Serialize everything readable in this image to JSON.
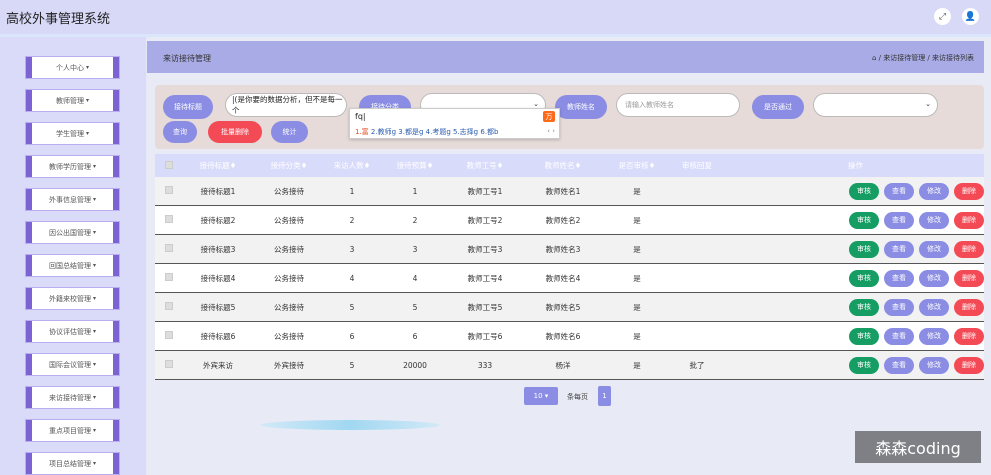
{
  "app": {
    "title": "高校外事管理系统"
  },
  "header": {
    "fullscreen_icon": "fullscreen-icon",
    "user_icon": "user-icon"
  },
  "sidebar": {
    "items": [
      {
        "label": "个人中心"
      },
      {
        "label": "教师管理"
      },
      {
        "label": "学生管理"
      },
      {
        "label": "教师学历管理"
      },
      {
        "label": "外事信息管理"
      },
      {
        "label": "因公出国管理"
      },
      {
        "label": "回国总结管理"
      },
      {
        "label": "外籍来校管理"
      },
      {
        "label": "协议评估管理"
      },
      {
        "label": "国际会议管理"
      },
      {
        "label": "来访接待管理"
      },
      {
        "label": "重点项目管理"
      },
      {
        "label": "项目总结管理"
      }
    ]
  },
  "breadcrumb": {
    "title": "来访接待管理",
    "path": "⌂ / 来访接待管理 / 来访接待列表"
  },
  "search": {
    "title_label": "接待标题",
    "title_value": "|(是你要的数据分析，但不是每一个",
    "category_label": "接待分类",
    "teacher_name_label": "教师姓名",
    "teacher_name_placeholder": "请输入教师姓名",
    "approved_label": "是否通过",
    "query_button": "查询",
    "batch_delete_button": "批量删除",
    "stats_button": "统计"
  },
  "ime": {
    "input": "fq|",
    "logo": "万",
    "candidates": [
      "1.富",
      "2.教师g",
      "3.都是g",
      "4.考题g",
      "5.志择g",
      "6.都b"
    ],
    "arrows": "‹ ›"
  },
  "table": {
    "columns": [
      "接待标题♦",
      "接待分类♦",
      "来访人数♦",
      "接待预算♦",
      "教师工号♦",
      "教师姓名♦",
      "是否审核♦",
      "审核回复",
      "操作"
    ],
    "rows": [
      {
        "title": "接待标题1",
        "category": "公务接待",
        "visitors": "1",
        "budget": "1",
        "teacher_no": "教师工号1",
        "teacher_name": "教师姓名1",
        "approved": "是",
        "reply": ""
      },
      {
        "title": "接待标题2",
        "category": "公务接待",
        "visitors": "2",
        "budget": "2",
        "teacher_no": "教师工号2",
        "teacher_name": "教师姓名2",
        "approved": "是",
        "reply": ""
      },
      {
        "title": "接待标题3",
        "category": "公务接待",
        "visitors": "3",
        "budget": "3",
        "teacher_no": "教师工号3",
        "teacher_name": "教师姓名3",
        "approved": "是",
        "reply": ""
      },
      {
        "title": "接待标题4",
        "category": "公务接待",
        "visitors": "4",
        "budget": "4",
        "teacher_no": "教师工号4",
        "teacher_name": "教师姓名4",
        "approved": "是",
        "reply": ""
      },
      {
        "title": "接待标题5",
        "category": "公务接待",
        "visitors": "5",
        "budget": "5",
        "teacher_no": "教师工号5",
        "teacher_name": "教师姓名5",
        "approved": "是",
        "reply": ""
      },
      {
        "title": "接待标题6",
        "category": "公务接待",
        "visitors": "6",
        "budget": "6",
        "teacher_no": "教师工号6",
        "teacher_name": "教师姓名6",
        "approved": "是",
        "reply": ""
      },
      {
        "title": "外宾来访",
        "category": "外宾接待",
        "visitors": "5",
        "budget": "20000",
        "teacher_no": "333",
        "teacher_name": "杨洋",
        "approved": "是",
        "reply": "批了"
      }
    ],
    "actions": {
      "review": "审核",
      "view": "查看",
      "edit": "修改",
      "delete": "删除"
    }
  },
  "pagination": {
    "page_size": "10 ▾",
    "per_page_label": "条每页",
    "current_page": "1"
  },
  "watermark": "森森coding",
  "colors": {
    "accent": "#8a8de3",
    "sidebar_border": "#7b63d4",
    "review_green": "#159d63",
    "delete_red": "#f44a56",
    "topbar": "#d7d9f7"
  }
}
